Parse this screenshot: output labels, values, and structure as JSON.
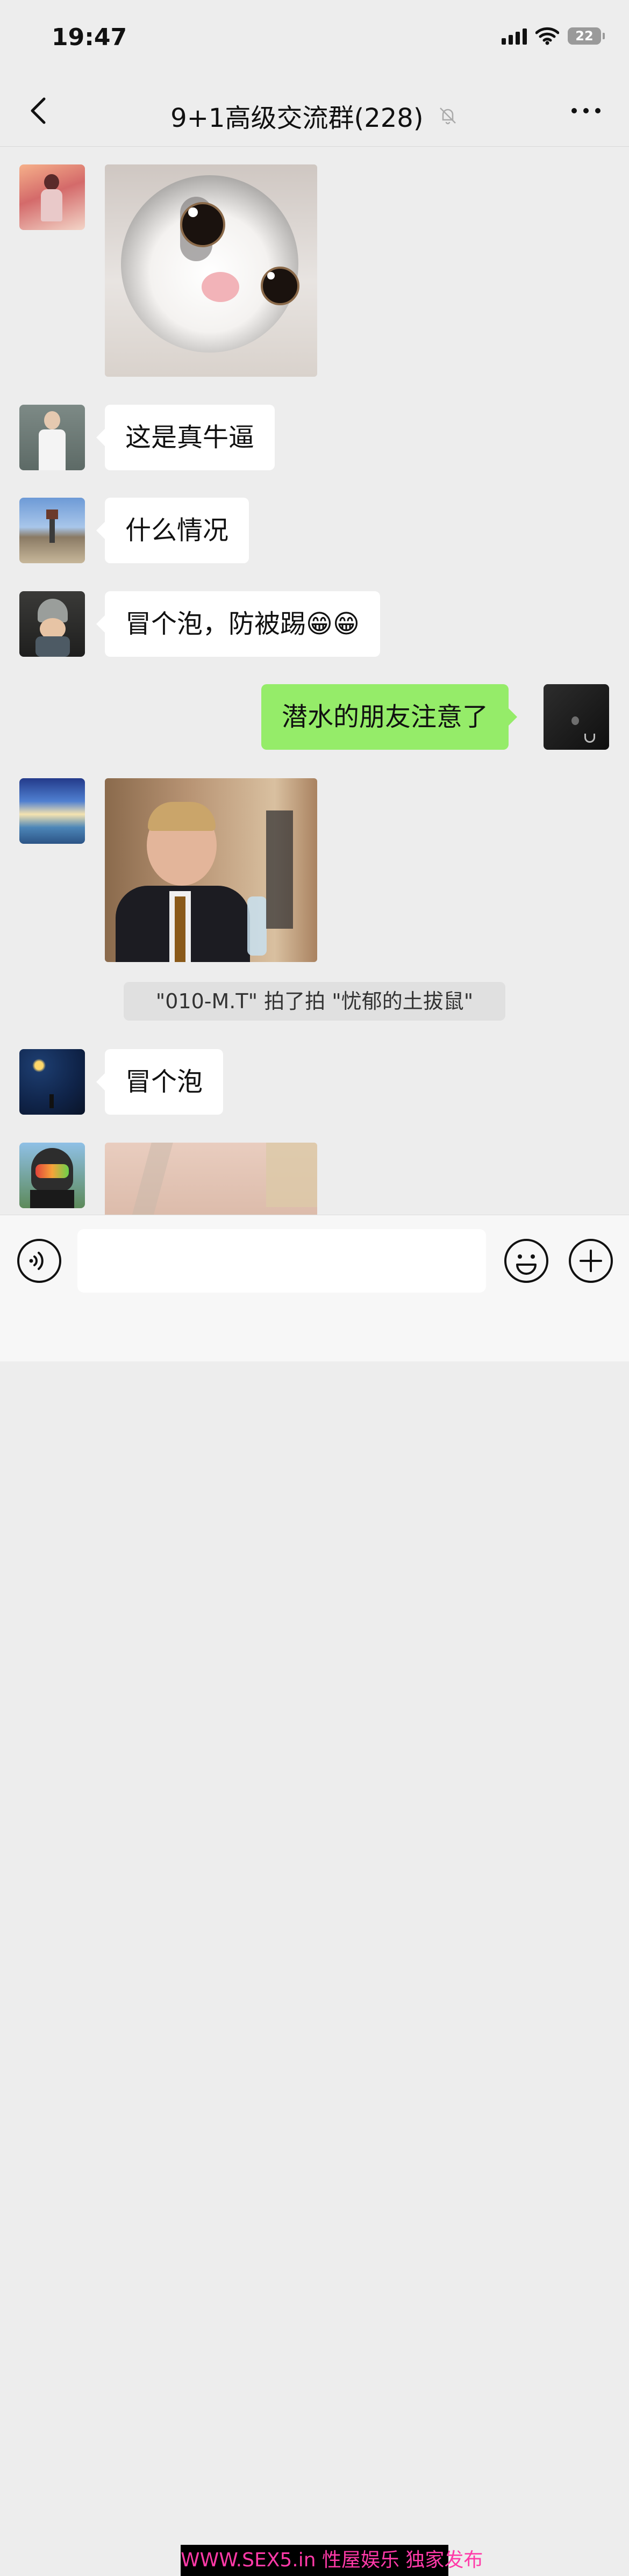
{
  "status_bar": {
    "time": "19:47",
    "battery": "22"
  },
  "header": {
    "back_label": "‹",
    "title": "9+1高级交流群(228)",
    "more_label": "···"
  },
  "messages": [
    {
      "side": "left",
      "kind": "sticker",
      "avatar": "person-sunset-avatar",
      "content": "cat-closeup-sticker"
    },
    {
      "side": "left",
      "kind": "text",
      "avatar": "young-man-avatar",
      "text": "这是真牛逼"
    },
    {
      "side": "left",
      "kind": "text",
      "avatar": "plaza-avatar",
      "text": "什么情况"
    },
    {
      "side": "left",
      "kind": "text",
      "avatar": "helmet-baby-avatar",
      "text": "冒个泡，防被踢😁😁"
    },
    {
      "side": "right",
      "kind": "text",
      "avatar": "dark-umbrella-avatar",
      "text": "潜水的朋友注意了"
    },
    {
      "side": "left",
      "kind": "sticker",
      "avatar": "painted-sky-avatar",
      "content": "man-with-water-bottle-sticker"
    },
    {
      "side": "center",
      "kind": "system",
      "text": "\"010-M.T\" 拍了拍 \"忧郁的土拔鼠\""
    },
    {
      "side": "left",
      "kind": "text",
      "avatar": "starry-night-avatar",
      "text": "冒个泡"
    },
    {
      "side": "left",
      "kind": "sticker",
      "avatar": "motorcycle-helmet-avatar",
      "content": "partial-photo-sticker"
    }
  ],
  "input_bar": {
    "placeholder": ""
  },
  "watermark": {
    "text": "WWW.SEX5.in 性屋娱乐 独家发布"
  },
  "colors": {
    "background": "#ededed",
    "own_bubble": "#95ec69",
    "other_bubble": "#ffffff"
  }
}
